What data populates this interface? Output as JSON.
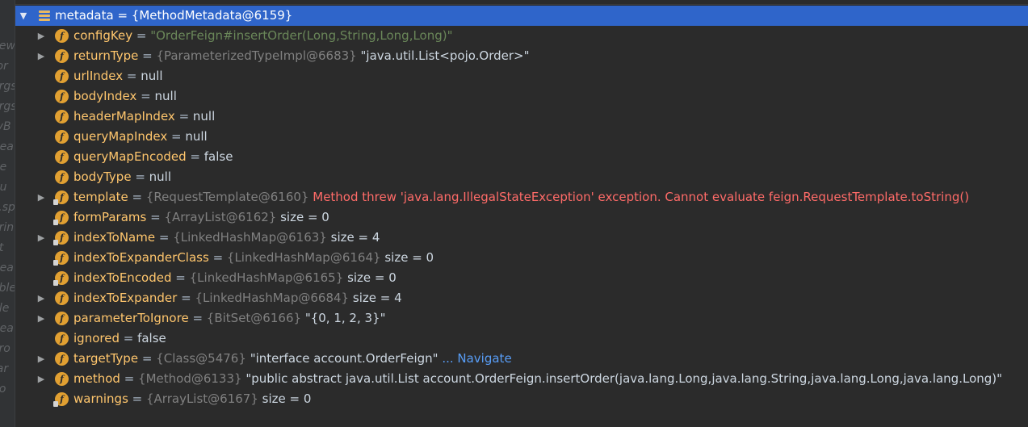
{
  "left_strip": [
    "new",
    "(or",
    "args",
    "args",
    "ryB",
    "Bea",
    "Be",
    "Au",
    "x.sp",
    "orin",
    "pt",
    "Bea",
    "able",
    "ble",
    "Bea",
    "Pro",
    "rar",
    "no"
  ],
  "root": {
    "label": "metadata = {MethodMetadata@6159}"
  },
  "colors": {
    "selection": "#2f65ca",
    "field_icon": "#e1a032",
    "error": "#ff6b68",
    "link": "#589df6"
  },
  "fields": [
    {
      "name": "configKey",
      "ref": "",
      "value": "\"OrderFeign#insertOrder(Long,String,Long,Long)\"",
      "style": "confstr",
      "extra": "",
      "expandable": true,
      "final": false,
      "icon": "field-icon"
    },
    {
      "name": "returnType",
      "ref": "{ParameterizedTypeImpl@6683}",
      "value": "\"java.util.List<pojo.Order>\"",
      "style": "strv",
      "extra": "",
      "expandable": true,
      "final": false,
      "icon": "field-icon"
    },
    {
      "name": "urlIndex",
      "ref": "",
      "value": "null",
      "style": "plain",
      "extra": "",
      "expandable": false,
      "final": false,
      "icon": "field-icon"
    },
    {
      "name": "bodyIndex",
      "ref": "",
      "value": "null",
      "style": "plain",
      "extra": "",
      "expandable": false,
      "final": false,
      "icon": "field-icon"
    },
    {
      "name": "headerMapIndex",
      "ref": "",
      "value": "null",
      "style": "plain",
      "extra": "",
      "expandable": false,
      "final": false,
      "icon": "field-icon"
    },
    {
      "name": "queryMapIndex",
      "ref": "",
      "value": "null",
      "style": "plain",
      "extra": "",
      "expandable": false,
      "final": false,
      "icon": "field-icon"
    },
    {
      "name": "queryMapEncoded",
      "ref": "",
      "value": "false",
      "style": "plain",
      "extra": "",
      "expandable": false,
      "final": false,
      "icon": "field-icon"
    },
    {
      "name": "bodyType",
      "ref": "",
      "value": "null",
      "style": "plain",
      "extra": "",
      "expandable": false,
      "final": false,
      "icon": "field-icon"
    },
    {
      "name": "template",
      "ref": "{RequestTemplate@6160}",
      "value": "Method threw 'java.lang.IllegalStateException' exception. Cannot evaluate feign.RequestTemplate.toString()",
      "style": "err",
      "extra": "",
      "expandable": true,
      "final": true,
      "icon": "final-field-icon"
    },
    {
      "name": "formParams",
      "ref": "{ArrayList@6162}",
      "value": " size = 0",
      "style": "plain",
      "extra": "",
      "expandable": false,
      "final": true,
      "icon": "final-field-icon"
    },
    {
      "name": "indexToName",
      "ref": "{LinkedHashMap@6163}",
      "value": " size = 4",
      "style": "plain",
      "extra": "",
      "expandable": true,
      "final": true,
      "icon": "final-field-icon"
    },
    {
      "name": "indexToExpanderClass",
      "ref": "{LinkedHashMap@6164}",
      "value": " size = 0",
      "style": "plain",
      "extra": "",
      "expandable": false,
      "final": true,
      "icon": "final-field-icon"
    },
    {
      "name": "indexToEncoded",
      "ref": "{LinkedHashMap@6165}",
      "value": " size = 0",
      "style": "plain",
      "extra": "",
      "expandable": false,
      "final": true,
      "icon": "final-field-icon"
    },
    {
      "name": "indexToExpander",
      "ref": "{LinkedHashMap@6684}",
      "value": " size = 4",
      "style": "plain",
      "extra": "",
      "expandable": true,
      "final": false,
      "icon": "field-icon"
    },
    {
      "name": "parameterToIgnore",
      "ref": "{BitSet@6166}",
      "value": "\"{0, 1, 2, 3}\"",
      "style": "strv",
      "extra": "",
      "expandable": true,
      "final": false,
      "icon": "field-icon"
    },
    {
      "name": "ignored",
      "ref": "",
      "value": "false",
      "style": "plain",
      "extra": "",
      "expandable": false,
      "final": false,
      "icon": "field-icon"
    },
    {
      "name": "targetType",
      "ref": "{Class@5476}",
      "value": "\"interface account.OrderFeign\"",
      "style": "strv",
      "extra": "... Navigate",
      "expandable": true,
      "final": false,
      "icon": "field-icon"
    },
    {
      "name": "method",
      "ref": "{Method@6133}",
      "value": "\"public abstract java.util.List account.OrderFeign.insertOrder(java.lang.Long,java.lang.String,java.lang.Long,java.lang.Long)\"",
      "style": "strv",
      "extra": "",
      "expandable": true,
      "final": false,
      "icon": "field-icon"
    },
    {
      "name": "warnings",
      "ref": "{ArrayList@6167}",
      "value": " size = 0",
      "style": "plain",
      "extra": "",
      "expandable": false,
      "final": true,
      "icon": "final-field-icon"
    }
  ]
}
